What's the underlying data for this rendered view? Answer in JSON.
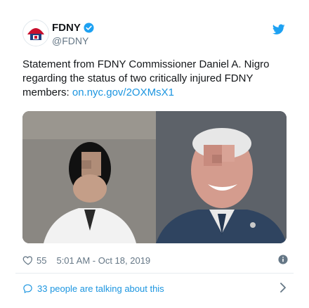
{
  "account": {
    "name": "FDNY",
    "handle": "@FDNY"
  },
  "tweet": {
    "text_pre": "Statement from FDNY Commissioner Daniel A. Nigro regarding the status of two critically injured FDNY members: ",
    "link": "on.nyc.gov/2OXMsX1"
  },
  "meta": {
    "likes": "55",
    "timestamp": "5:01 AM - Oct 18, 2019"
  },
  "conversation": {
    "label": "33 people are talking about this"
  },
  "colors": {
    "link": "#1b95e0",
    "text": "#14171a",
    "muted": "#657786",
    "twitter_blue": "#1da1f2"
  },
  "icons": {
    "verified": "verified-badge-icon",
    "twitter": "twitter-bird-icon",
    "like": "heart-icon",
    "info": "info-icon",
    "reply": "speech-bubble-icon",
    "more": "chevron-right-icon"
  }
}
